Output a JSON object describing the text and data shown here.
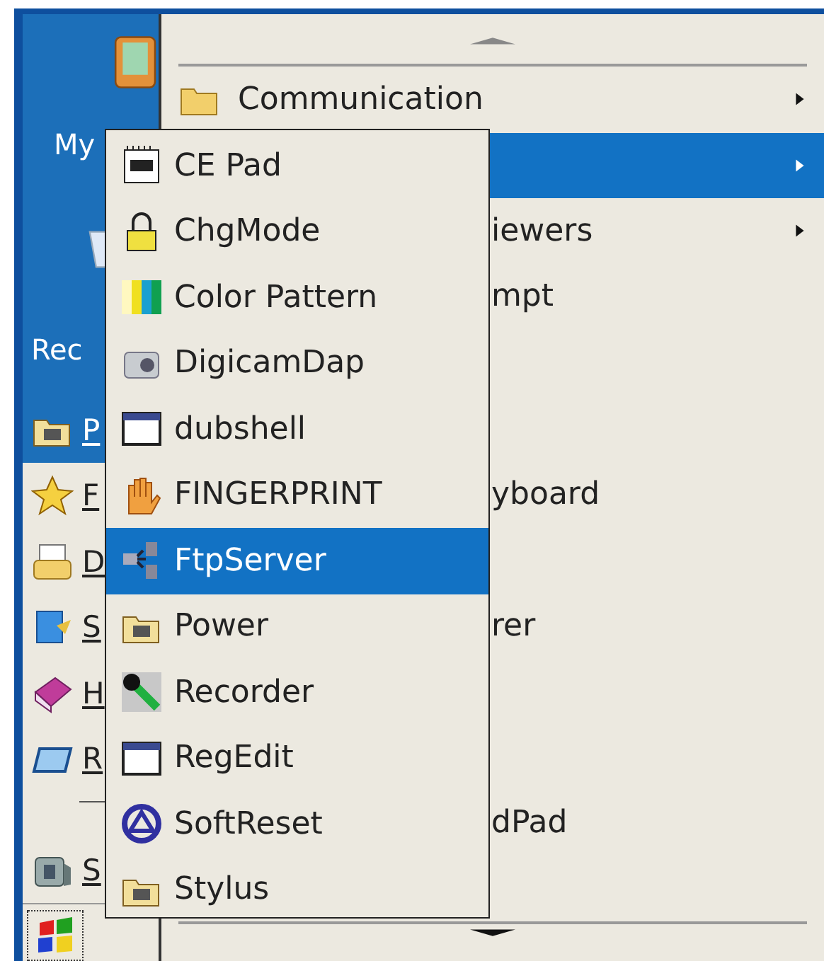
{
  "desktop": {
    "icons": [
      {
        "label": "My"
      },
      {
        "label": "Rec"
      }
    ]
  },
  "start_menu": {
    "items": [
      {
        "kind": "item",
        "label": "P",
        "selected": true
      },
      {
        "kind": "item",
        "label": "F",
        "selected": false
      },
      {
        "kind": "item",
        "label": "D",
        "selected": false
      },
      {
        "kind": "item",
        "label": "S",
        "selected": false
      },
      {
        "kind": "item",
        "label": "H",
        "selected": false
      },
      {
        "kind": "item",
        "label": "R",
        "selected": false
      },
      {
        "kind": "separator"
      },
      {
        "kind": "item",
        "label": "S",
        "selected": false
      }
    ]
  },
  "programs_menu": {
    "items": [
      {
        "label": "Communication",
        "selected": false,
        "submenu": true
      },
      {
        "selected": true,
        "submenu": true
      },
      {
        "label": "iewers",
        "selected": false,
        "submenu": true
      },
      {
        "label": "mpt",
        "selected": false,
        "submenu": false
      },
      {
        "selected": false,
        "submenu": false
      },
      {
        "selected": false,
        "submenu": false
      },
      {
        "label": "yboard",
        "selected": false,
        "submenu": false
      },
      {
        "selected": false,
        "submenu": false
      },
      {
        "label": "rer",
        "selected": false,
        "submenu": false
      },
      {
        "selected": false,
        "submenu": false
      },
      {
        "selected": false,
        "submenu": false
      },
      {
        "label": "dPad",
        "selected": false,
        "submenu": false
      }
    ]
  },
  "submenu": {
    "items": [
      {
        "label": "CE Pad",
        "selected": false
      },
      {
        "label": "ChgMode",
        "selected": false
      },
      {
        "label": "Color Pattern",
        "selected": false
      },
      {
        "label": "DigicamDap",
        "selected": false
      },
      {
        "label": "dubshell",
        "selected": false
      },
      {
        "label": "FINGERPRINT",
        "selected": false
      },
      {
        "label": "FtpServer",
        "selected": true
      },
      {
        "label": "Power",
        "selected": false
      },
      {
        "label": "Recorder",
        "selected": false
      },
      {
        "label": "RegEdit",
        "selected": false
      },
      {
        "label": "SoftReset",
        "selected": false
      },
      {
        "label": "Stylus",
        "selected": false
      }
    ]
  }
}
